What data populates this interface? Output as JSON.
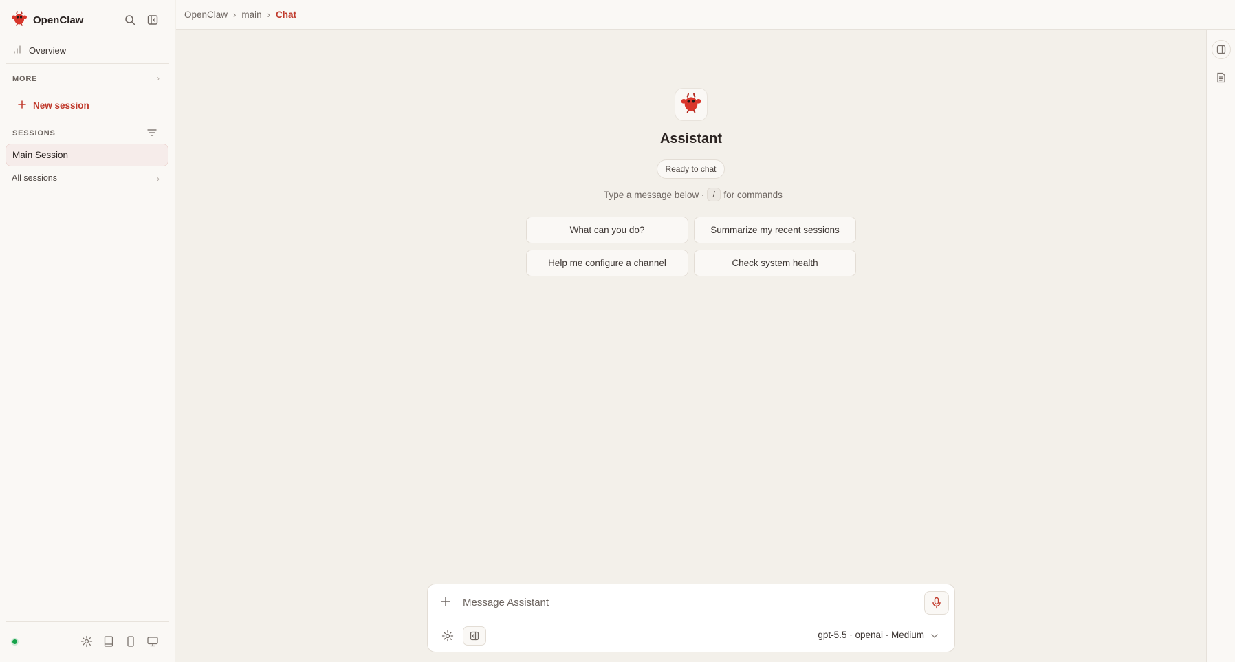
{
  "app": {
    "name": "OpenClaw",
    "accent": "#c0392b",
    "logo_icon": "crab-mascot-icon"
  },
  "sidebar": {
    "search_icon": "search-icon",
    "collapse_icon": "sidebar-toggle-icon",
    "overview_label": "Overview",
    "more_label": "MORE",
    "new_session_label": "New session",
    "sessions_label": "SESSIONS",
    "active_session": "Main Session",
    "all_sessions_label": "All sessions",
    "status_color": "#16a34a",
    "bottom_icons": [
      "gear-icon",
      "tablet-icon",
      "phone-icon",
      "monitor-icon"
    ]
  },
  "breadcrumb": {
    "items": [
      "OpenClaw",
      "main"
    ],
    "separator": "›",
    "current": "Chat"
  },
  "hero": {
    "title": "Assistant",
    "status": "Ready to chat",
    "hint_before": "Type a message below ·",
    "hint_key": "/",
    "hint_after": "for commands"
  },
  "suggestions": [
    "What can you do?",
    "Summarize my recent sessions",
    "Help me configure a channel",
    "Check system health"
  ],
  "composer": {
    "placeholder": "Message Assistant",
    "model_label": "gpt-5.5 · openai · Medium"
  }
}
